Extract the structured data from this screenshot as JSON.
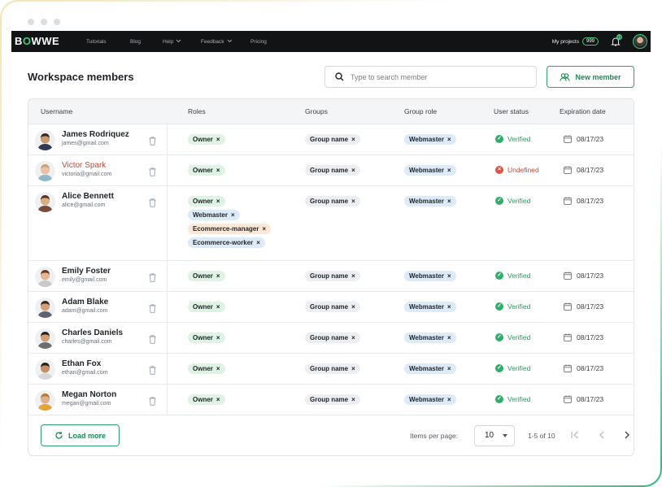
{
  "window": {
    "dots": 3
  },
  "topbar": {
    "logo_left": "B",
    "logo_o": "O",
    "logo_right": "WWE",
    "nav": [
      {
        "label": "Tutorials",
        "has_caret": false
      },
      {
        "label": "Blog",
        "has_caret": false
      },
      {
        "label": "Help",
        "has_caret": true
      },
      {
        "label": "Feedback",
        "has_caret": true
      },
      {
        "label": "Pricing",
        "has_caret": false
      }
    ],
    "projects_label": "My projects",
    "projects_count": "999",
    "notifications_count": "12",
    "icons": [
      "bell-icon",
      "profile-avatar"
    ]
  },
  "page": {
    "title": "Workspace members",
    "search_placeholder": "Type to search member",
    "new_member_label": "New member"
  },
  "table": {
    "columns": [
      "Username",
      "Roles",
      "Groups",
      "Group role",
      "User status",
      "Expiration date"
    ],
    "rows": [
      {
        "name": "James Rodriquez",
        "email": "james@gmail.com",
        "highlight": false,
        "roles": [
          {
            "label": "Owner",
            "color": "green"
          }
        ],
        "groups": [
          "Group name"
        ],
        "group_roles": [
          "Webmaster"
        ],
        "status": "Verified",
        "status_ok": true,
        "expiration": "08/17/23",
        "avatar": {
          "skin": "#c99a72",
          "hair": "#3b2a20",
          "shirt": "#2f3b52"
        }
      },
      {
        "name": "Victor Spark",
        "email": "victoria@gmail.com",
        "highlight": true,
        "roles": [
          {
            "label": "Owner",
            "color": "green"
          }
        ],
        "groups": [
          "Group name"
        ],
        "group_roles": [
          "Webmaster"
        ],
        "status": "Undefined",
        "status_ok": false,
        "expiration": "08/17/23",
        "avatar": {
          "skin": "#e6c3a6",
          "hair": "#c9a377",
          "shirt": "#8eb9c9"
        }
      },
      {
        "name": "Alice Bennett",
        "email": "alice@gmail.com",
        "highlight": false,
        "roles": [
          {
            "label": "Owner",
            "color": "green"
          },
          {
            "label": "Webmaster",
            "color": "blue"
          },
          {
            "label": "Ecommerce-manager",
            "color": "orange"
          },
          {
            "label": "Ecommerce-worker",
            "color": "blue"
          }
        ],
        "groups": [
          "Group name"
        ],
        "group_roles": [
          "Webmaster"
        ],
        "status": "Verified",
        "status_ok": true,
        "expiration": "08/17/23",
        "avatar": {
          "skin": "#d9ab87",
          "hair": "#5a3422",
          "shirt": "#7a4a3a"
        }
      },
      {
        "name": "Emily Foster",
        "email": "emily@gmail.com",
        "highlight": false,
        "roles": [
          {
            "label": "Owner",
            "color": "green"
          }
        ],
        "groups": [
          "Group name"
        ],
        "group_roles": [
          "Webmaster"
        ],
        "status": "Verified",
        "status_ok": true,
        "expiration": "08/17/23",
        "avatar": {
          "skin": "#e2b796",
          "hair": "#6a3b24",
          "shirt": "#c9c9c9"
        }
      },
      {
        "name": "Adam Blake",
        "email": "adam@gmail.com",
        "highlight": false,
        "roles": [
          {
            "label": "Owner",
            "color": "green"
          }
        ],
        "groups": [
          "Group name"
        ],
        "group_roles": [
          "Webmaster"
        ],
        "status": "Verified",
        "status_ok": true,
        "expiration": "08/17/23",
        "avatar": {
          "skin": "#d2a07c",
          "hair": "#3a2a22",
          "shirt": "#5b6470"
        }
      },
      {
        "name": "Charles Daniels",
        "email": "charles@gmail.com",
        "highlight": false,
        "roles": [
          {
            "label": "Owner",
            "color": "green"
          }
        ],
        "groups": [
          "Group name"
        ],
        "group_roles": [
          "Webmaster"
        ],
        "status": "Verified",
        "status_ok": true,
        "expiration": "08/17/23",
        "avatar": {
          "skin": "#cf9d7a",
          "hair": "#2b211b",
          "shirt": "#6e6e6e"
        }
      },
      {
        "name": "Ethan Fox",
        "email": "ethan@gmail.com",
        "highlight": false,
        "roles": [
          {
            "label": "Owner",
            "color": "green"
          }
        ],
        "groups": [
          "Group name"
        ],
        "group_roles": [
          "Webmaster"
        ],
        "status": "Verified",
        "status_ok": true,
        "expiration": "08/17/23",
        "avatar": {
          "skin": "#c48e69",
          "hair": "#2a1f18",
          "shirt": "#d5d7da"
        }
      },
      {
        "name": "Megan Norton",
        "email": "megan@gmail.com",
        "highlight": false,
        "roles": [
          {
            "label": "Owner",
            "color": "green"
          }
        ],
        "groups": [
          "Group name"
        ],
        "group_roles": [
          "Webmaster"
        ],
        "status": "Verified",
        "status_ok": true,
        "expiration": "08/17/23",
        "avatar": {
          "skin": "#e0b08e",
          "hair": "#b97a2f",
          "shirt": "#e8a23a"
        }
      }
    ]
  },
  "footer": {
    "load_more_label": "Load more",
    "items_per_page_label": "Items per page:",
    "items_per_page_value": "10",
    "range_label": "1-5 of 10"
  },
  "colors": {
    "accent": "#2fa56b",
    "topbar_bg": "#121314",
    "error": "#d2442f"
  }
}
